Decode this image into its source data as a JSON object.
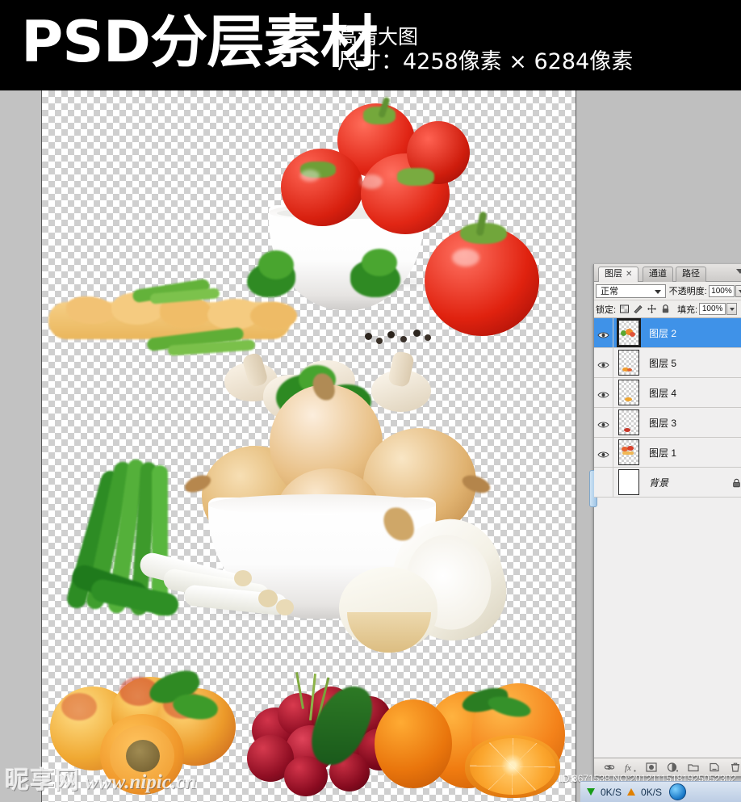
{
  "banner": {
    "title": "PSD分层素材",
    "subtitle_1": "高清大图",
    "subtitle_2": "尺寸：4258像素 × 6284像素"
  },
  "canvas": {
    "description": "Transparent-checkerboard canvas showing three stacked food cut-out groups",
    "groups": [
      {
        "name": "tomato-bowl",
        "items": "白碗盛番茄、蘑菇、意面、香菜、胡椒"
      },
      {
        "name": "onion-bowl",
        "items": "白碗盛洋葱、大葱、切开的洋葱"
      },
      {
        "name": "fruit-row",
        "items": "杏、樱桃、橙子"
      }
    ]
  },
  "layers_panel": {
    "tabs": [
      {
        "label": "图层",
        "closable": true,
        "active": true
      },
      {
        "label": "通道",
        "closable": false,
        "active": false
      },
      {
        "label": "路径",
        "closable": false,
        "active": false
      }
    ],
    "blend_mode": "正常",
    "opacity_label": "不透明度:",
    "opacity_value": "100%",
    "lock_label": "锁定:",
    "fill_label": "填充:",
    "fill_value": "100%",
    "lock_icons": [
      "lock-transparency-icon",
      "lock-image-icon",
      "lock-position-icon",
      "lock-all-icon"
    ],
    "layers": [
      {
        "name": "图层 2",
        "visible": true,
        "selected": true,
        "locked": false,
        "thumb": "transparent"
      },
      {
        "name": "图层 5",
        "visible": true,
        "selected": false,
        "locked": false,
        "thumb": "transparent"
      },
      {
        "name": "图层 4",
        "visible": true,
        "selected": false,
        "locked": false,
        "thumb": "transparent"
      },
      {
        "name": "图层 3",
        "visible": true,
        "selected": false,
        "locked": false,
        "thumb": "transparent"
      },
      {
        "name": "图层 1",
        "visible": true,
        "selected": false,
        "locked": false,
        "thumb": "transparent"
      },
      {
        "name": "背景",
        "visible": false,
        "selected": false,
        "locked": true,
        "thumb": "white"
      }
    ],
    "toolbar_icons": [
      "link-layers-icon",
      "layer-style-fx-icon",
      "add-layer-mask-icon",
      "new-adjustment-layer-icon",
      "new-group-icon",
      "new-layer-icon",
      "delete-layer-icon"
    ]
  },
  "watermark": {
    "site_cn": "昵享网",
    "site_url": "www.nipic.cn",
    "id_text": "ID:3671538 NO:20121115181925052302"
  },
  "taskbar": {
    "download_speed": "0K/S",
    "upload_speed": "0K/S",
    "browser_icon": "internet-explorer-icon"
  },
  "colors": {
    "banner_bg": "#000000",
    "workspace_bg": "#bfbfbf",
    "panel_bg": "#f0efef",
    "selection_blue": "#3f92e8",
    "canvas_checker": "#cfcfcf"
  }
}
